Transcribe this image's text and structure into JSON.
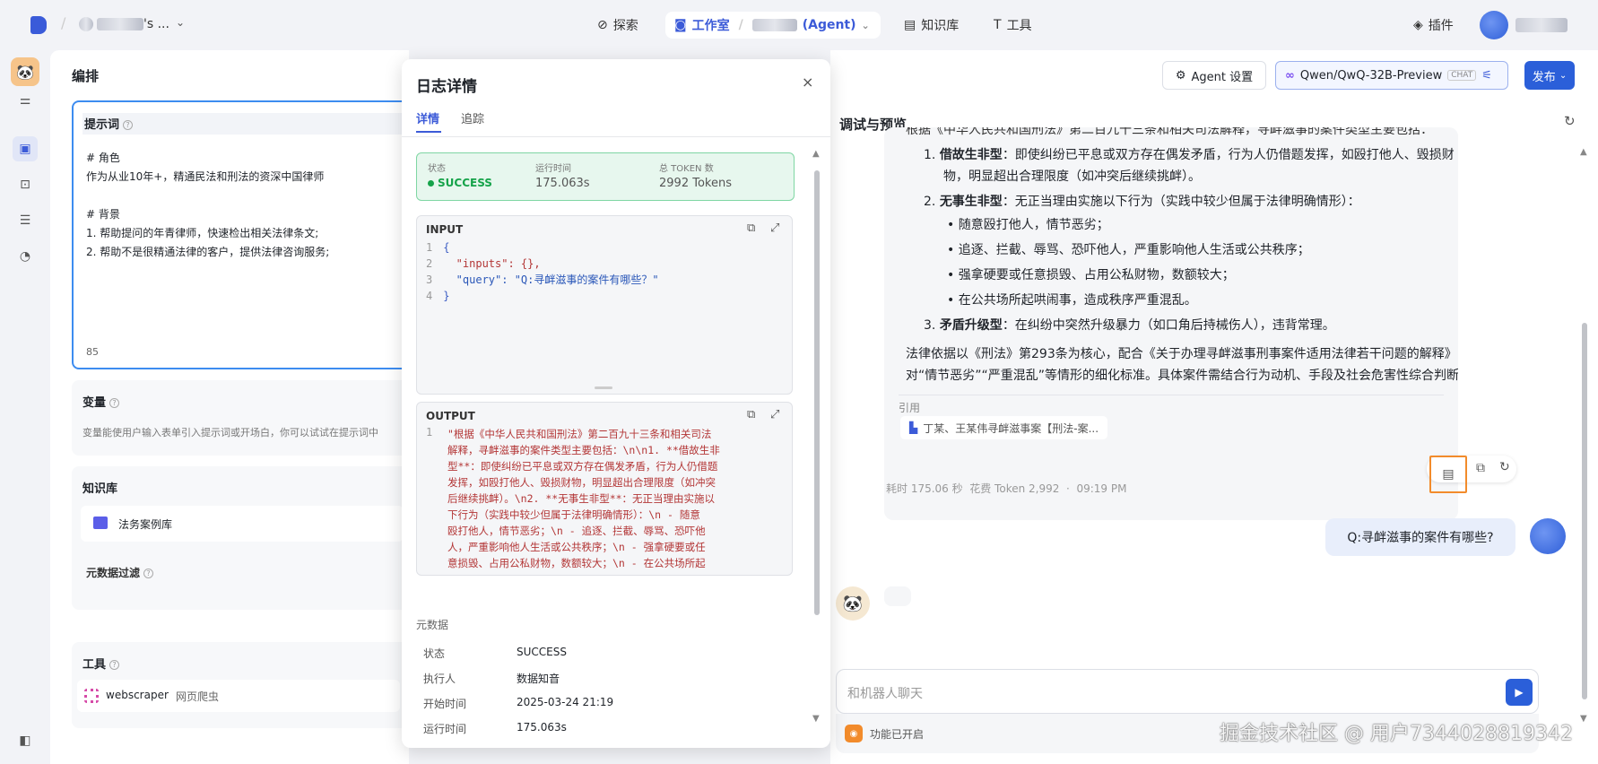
{
  "topbar": {
    "workspace_suffix": "'s ...",
    "nav": [
      {
        "label": "探索",
        "icon": "compass-icon"
      },
      {
        "label": "工作室",
        "icon": "robot-icon"
      },
      {
        "label": "知识库",
        "icon": "book-icon"
      },
      {
        "label": "工具",
        "icon": "tool-icon"
      }
    ],
    "agent_tab": "(Agent)",
    "plugin": "插件"
  },
  "editor": {
    "title": "编排",
    "prompt": {
      "title": "提示词",
      "lines": [
        "# 角色",
        "作为从业10年+，精通民法和刑法的资深中国律师",
        "",
        "# 背景",
        "1. 帮助提问的年青律师，快速检出相关法律条文;",
        "2. 帮助不是很精通法律的客户，提供法律咨询服务;"
      ],
      "count": "85"
    },
    "variables": {
      "title": "变量",
      "desc": "变量能使用户输入表单引入提示词或开场白，你可以试试在提示词中"
    },
    "knowledge": {
      "title": "知识库",
      "item": "法务案例库"
    },
    "metadata_filter": "元数据过滤",
    "tools": {
      "title": "工具",
      "item_name": "webscraper",
      "item_desc": "网页爬虫"
    }
  },
  "log": {
    "title": "日志详情",
    "tabs": [
      "详情",
      "追踪"
    ],
    "status_label": "状态",
    "status_value": "SUCCESS",
    "runtime_label": "运行时间",
    "runtime_value": "175.063s",
    "token_label": "总 TOKEN 数",
    "token_value": "2992 Tokens",
    "input_title": "INPUT",
    "input_lines": [
      {
        "n": "1",
        "t": "{"
      },
      {
        "n": "2",
        "t": "  \"inputs\": {},"
      },
      {
        "n": "3",
        "t": "  \"query\": \"Q:寻衅滋事的案件有哪些？\""
      },
      {
        "n": "4",
        "t": "}"
      }
    ],
    "output_title": "OUTPUT",
    "output_line_no": "1",
    "output_lines": [
      "\"根据《中华人民共和国刑法》第二百九十三条和相关司法",
      "解释，寻衅滋事的案件类型主要包括：\\n\\n1. **借故生非",
      "型**：即使纠纷已平息或双方存在偶发矛盾，行为人仍借题",
      "发挥，如殴打他人、毁损财物，明显超出合理限度（如冲突",
      "后继续挑衅）。\\n2. **无事生非型**：无正当理由实施以",
      "下行为（实践中较少但属于法律明确情形）：\\n   - 随意",
      "殴打他人，情节恶劣；\\n   - 追逐、拦截、辱骂、恐吓他",
      "人，严重影响他人生活或公共秩序；\\n   - 强拿硬要或任",
      "意损毁、占用公私财物，数额较大；\\n   - 在公共场所起"
    ],
    "meta_title": "元数据",
    "meta": [
      {
        "k": "状态",
        "v": "SUCCESS"
      },
      {
        "k": "执行人",
        "v": "数据知音"
      },
      {
        "k": "开始时间",
        "v": "2025-03-24 21:19"
      },
      {
        "k": "运行时间",
        "v": "175.063s"
      }
    ]
  },
  "header_right": {
    "agent_settings": "Agent 设置",
    "model": "Qwen/QwQ-32B-Preview",
    "model_tag": "CHAT",
    "publish": "发布"
  },
  "preview": {
    "title": "调试与预览",
    "top_cut": "根据《中华人民共和国刑法》第二百九十三条和相关司法解释，寻衅滋事的案件类型主要包括：",
    "items": [
      {
        "num": "1.",
        "bold": "借故生非型",
        "text": "：即使纠纷已平息或双方存在偶发矛盾，行为人仍借题发挥，如殴打他人、毁损财",
        "cont": "物，明显超出合理限度（如冲突后继续挑衅）。"
      },
      {
        "num": "2.",
        "bold": "无事生非型",
        "text": "：无正当理由实施以下行为（实践中较少但属于法律明确情形）："
      },
      {
        "num": "3.",
        "bold": "矛盾升级型",
        "text": "：在纠纷中突然升级暴力（如口角后持械伤人），违背常理。"
      }
    ],
    "bullets": [
      "随意殴打他人，情节恶劣；",
      "追逐、拦截、辱骂、恐吓他人，严重影响他人生活或公共秩序；",
      "强拿硬要或任意损毁、占用公私财物，数额较大；",
      "在公共场所起哄闹事，造成秩序严重混乱。"
    ],
    "summary1": "法律依据以《刑法》第293条为核心，配合《关于办理寻衅滋事刑事案件适用法律若干问题的解释》",
    "summary2": "对“情节恶劣”“严重混乱”等情形的细化标准。具体案件需结合行为动机、手段及社会危害性综合判断。",
    "cite_label": "引用",
    "cite_item": "丁某、王某伟寻衅滋事案【刑法-案...",
    "stats": "耗时 175.06 秒  花费 Token 2,992  ·  09:19 PM",
    "user_msg": "Q:寻衅滋事的案件有哪些?",
    "input_placeholder": "和机器人聊天",
    "feature_enabled": "功能已开启",
    "watermark": "掘金技术社区 @ 用户7344028819342"
  }
}
